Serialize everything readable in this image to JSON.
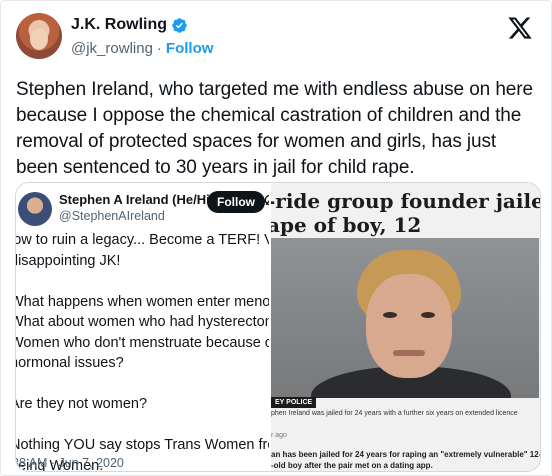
{
  "author": {
    "name": "J.K. Rowling",
    "handle": "@jk_rowling",
    "separator": "·",
    "follow_label": "Follow",
    "verified_color": "#1d9bf0"
  },
  "tweet": {
    "text": "Stephen Ireland, who targeted me with endless abuse on here because I oppose the chemical castration of children and the removal of protected spaces for women and girls, has just been sentenced to 30 years in jail for child rape."
  },
  "embedded_tweet": {
    "name": "Stephen A Ireland (He/Hi...",
    "handle": "@StephenAIreland",
    "follow_label": "Follow",
    "lines": [
      "low to ruin a legacy... Become a TERF! Very\ndisappointing JK!",
      "What happens when women enter menopause?\nWhat about women who had hysterectomies?\nWomen who don't menstruate because of\nhormonal issues?",
      "Are they not women?",
      "Nothing YOU say stops Trans Women from\nbeing Women."
    ],
    "date": "38 AM · Jun 7, 2020"
  },
  "news_clip": {
    "headline_line1": "-ride group founder jailed fo",
    "headline_line2": "ape of boy, 12",
    "photo_tag": "EY POLICE",
    "caption": "phen Ireland was jailed for 24 years with a further six years on extended licence",
    "time_ago": "r ago",
    "sub_text": "an has been jailed for 24 years for raping an \"extremely vulnerable\" 12-\n-old boy after the pair met on a dating app."
  },
  "icons": {
    "brand": "x-logo-icon",
    "badge": "verified-badge-icon",
    "grok": "grok-icon"
  }
}
